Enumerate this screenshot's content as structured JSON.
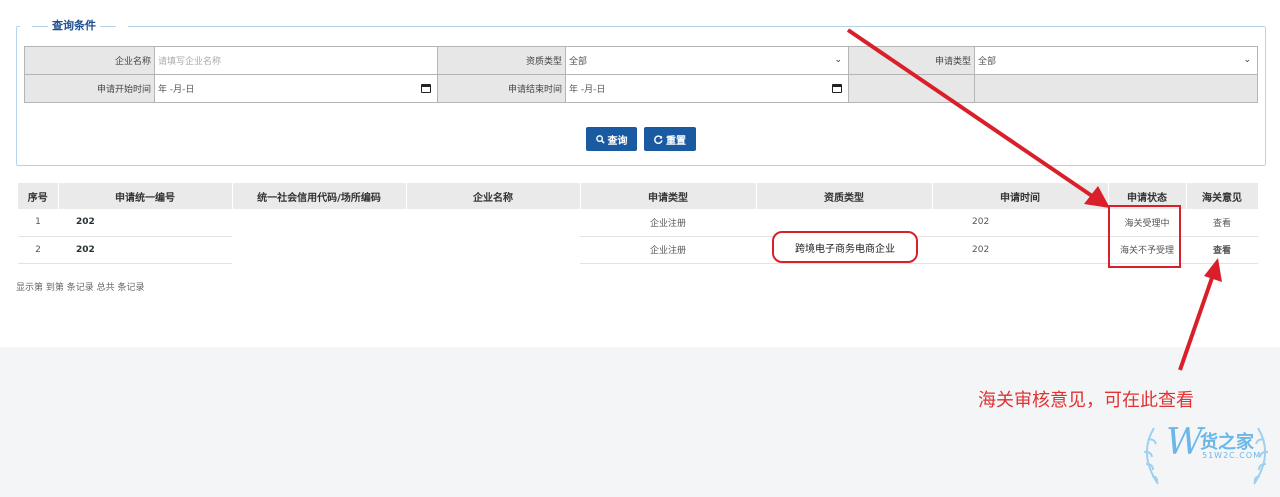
{
  "query": {
    "legend": "查询条件",
    "company_label": "企业名称",
    "company_placeholder": "请填写企业名称",
    "qual_label": "资质类型",
    "qual_value": "全部",
    "apply_type_label": "申请类型",
    "apply_type_value": "全部",
    "start_label": "申请开始时间",
    "start_value": "年 -月-日",
    "end_label": "申请结束时间",
    "end_value": "年 -月-日",
    "search_btn": "查询",
    "reset_btn": "重置"
  },
  "table": {
    "headers": [
      "序号",
      "申请统一编号",
      "统一社会信用代码/场所编码",
      "企业名称",
      "申请类型",
      "资质类型",
      "申请时间",
      "申请状态",
      "海关意见"
    ],
    "rows": [
      {
        "no": "1",
        "code": "202",
        "credit": "",
        "company": "",
        "type": "企业注册",
        "qual": "",
        "date": "202",
        "status": "海关受理中",
        "opinion": "查看"
      },
      {
        "no": "2",
        "code": "202",
        "credit": "",
        "company": "",
        "type": "企业注册",
        "qual": "跨境电子商务电商企业",
        "date": "202",
        "status": "海关不予受理",
        "opinion": "查看"
      }
    ]
  },
  "pager": "显示第 到第 条记录 总共 条记录",
  "annotation": "海关审核意见，可在此查看",
  "watermark": {
    "logo": "W",
    "name": "货之家",
    "domain": "51W2C.COM"
  },
  "colors": {
    "accent": "#1a5aa0",
    "highlight": "#d9202a",
    "annotation": "#e03232"
  }
}
